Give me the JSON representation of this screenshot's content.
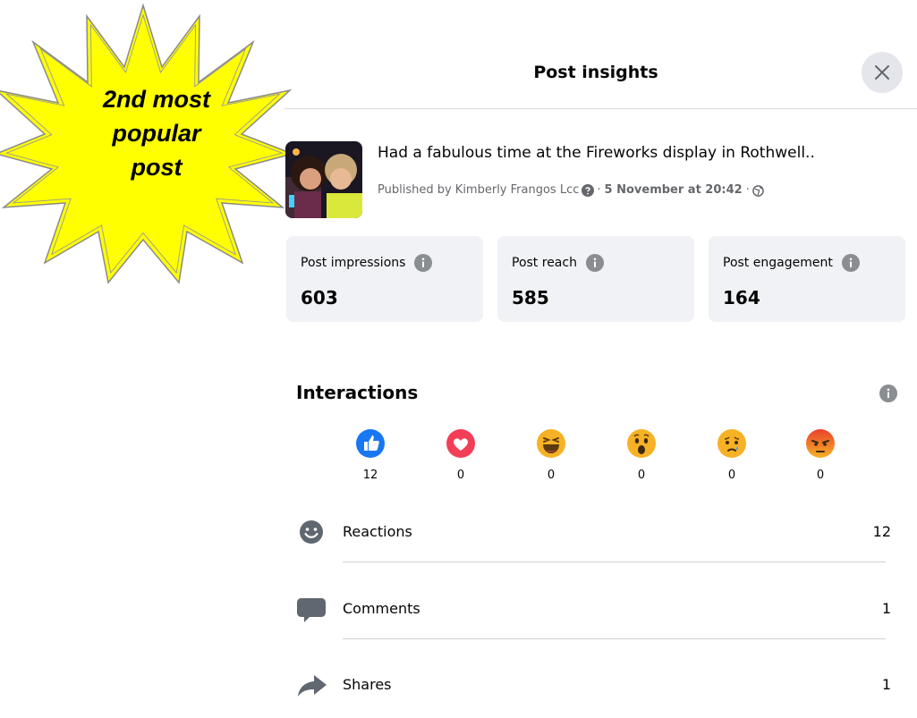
{
  "badge": {
    "line1": "2nd most",
    "line2": "popular",
    "line3": "post"
  },
  "dialog": {
    "title": "Post insights",
    "close_icon": "close-icon"
  },
  "post": {
    "text": "Had a fabulous time at the Fireworks display in Rothwell..",
    "published_prefix": "Published by Kimberly Frangos Lcc",
    "separator": "·",
    "date": "5 November at 20:42",
    "audience_icon": "globe-icon"
  },
  "stats": [
    {
      "label": "Post impressions",
      "value": "603"
    },
    {
      "label": "Post reach",
      "value": "585"
    },
    {
      "label": "Post engagement",
      "value": "164"
    }
  ],
  "interactions": {
    "title": "Interactions",
    "reactions": [
      {
        "type": "like",
        "count": "12"
      },
      {
        "type": "love",
        "count": "0"
      },
      {
        "type": "haha",
        "count": "0"
      },
      {
        "type": "wow",
        "count": "0"
      },
      {
        "type": "sad",
        "count": "0"
      },
      {
        "type": "angry",
        "count": "0"
      }
    ],
    "rows": [
      {
        "label": "Reactions",
        "value": "12",
        "icon": "smiley-icon"
      },
      {
        "label": "Comments",
        "value": "1",
        "icon": "comment-icon"
      },
      {
        "label": "Shares",
        "value": "1",
        "icon": "share-icon"
      }
    ]
  },
  "colors": {
    "badge_fill": "#ffff00",
    "card_bg": "#f0f2f5",
    "like_blue": "#1877f2",
    "love_red": "#f33e58"
  }
}
